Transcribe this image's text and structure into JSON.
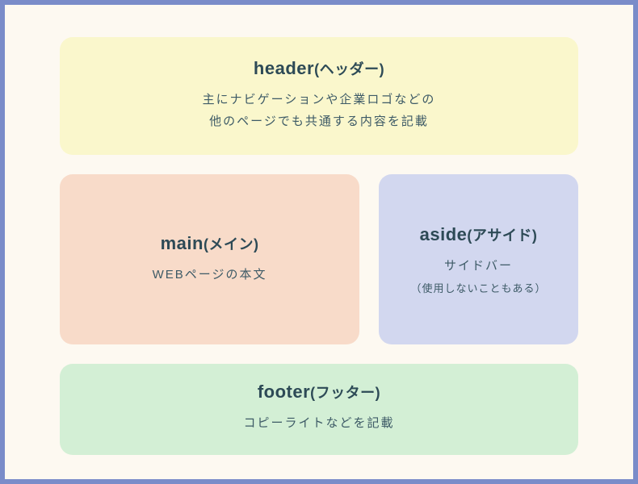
{
  "header": {
    "title_en": "header",
    "title_ja": "(ヘッダー)",
    "desc_line1": "主にナビゲーションや企業ロゴなどの",
    "desc_line2": "他のページでも共通する内容を記載"
  },
  "main": {
    "title_en": "main",
    "title_ja": "(メイン)",
    "desc": "WEBページの本文"
  },
  "aside": {
    "title_en": "aside",
    "title_ja": "(アサイド)",
    "desc": "サイドバー",
    "note": "（使用しないこともある）"
  },
  "footer": {
    "title_en": "footer",
    "title_ja": "(フッター)",
    "desc": "コピーライトなどを記載"
  }
}
